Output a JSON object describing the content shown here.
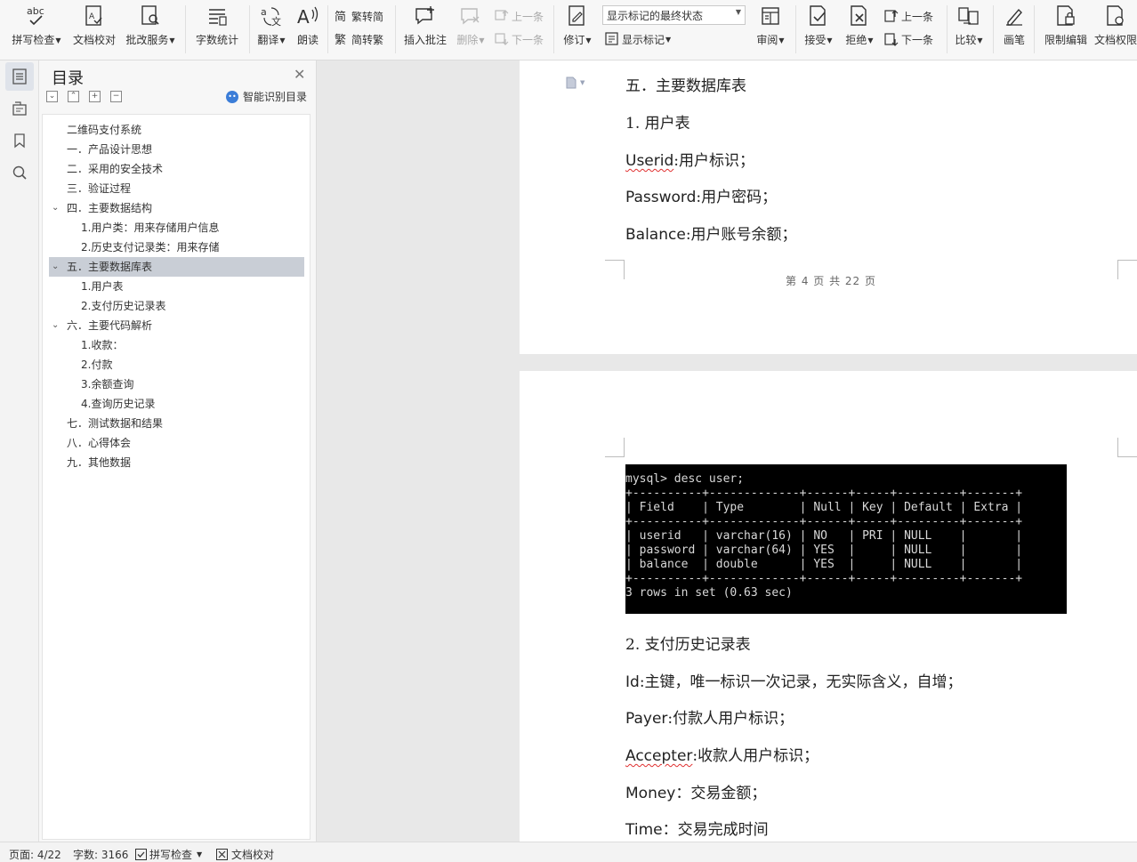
{
  "ribbon": {
    "spell_check": "拼写检查",
    "doc_proof": "文档校对",
    "revise_service": "批改服务",
    "word_count": "字数统计",
    "translate": "翻译",
    "read_aloud": "朗读",
    "trad_to_simp": "繁转简",
    "simp_to_trad": "简转繁",
    "insert_comment": "插入批注",
    "delete": "删除",
    "prev_comment": "上一条",
    "next_comment": "下一条",
    "track_changes": "修订",
    "mark_state": "显示标记的最终状态",
    "show_markup": "显示标记",
    "review": "审阅",
    "accept": "接受",
    "reject": "拒绝",
    "prev_change": "上一条",
    "next_change": "下一条",
    "compare": "比较",
    "pen": "画笔",
    "restrict_edit": "限制编辑",
    "doc_rights": "文档权限"
  },
  "toc": {
    "title": "目录",
    "smart_toc": "智能识别目录",
    "items": [
      {
        "label": "二维码支付系统",
        "level": 0
      },
      {
        "label": "一．产品设计思想",
        "level": 0
      },
      {
        "label": "二．采用的安全技术",
        "level": 0
      },
      {
        "label": "三．验证过程",
        "level": 0
      },
      {
        "label": "四．主要数据结构",
        "level": 0
      },
      {
        "label": "1.用户类：用来存储用户信息",
        "level": 1
      },
      {
        "label": "2.历史支付记录类：用来存储",
        "level": 1
      },
      {
        "label": "五．主要数据库表",
        "level": 0
      },
      {
        "label": "1.用户表",
        "level": 1
      },
      {
        "label": "2.支付历史记录表",
        "level": 1
      },
      {
        "label": "六．主要代码解析",
        "level": 0
      },
      {
        "label": "1.收款：",
        "level": 1
      },
      {
        "label": "2.付款",
        "level": 1
      },
      {
        "label": "3.余额查询",
        "level": 1
      },
      {
        "label": "4.查询历史记录",
        "level": 1
      },
      {
        "label": "七．测试数据和结果",
        "level": 0
      },
      {
        "label": "八．心得体会",
        "level": 0
      },
      {
        "label": "九．其他数据",
        "level": 0
      }
    ]
  },
  "page1": {
    "heading": "五．主要数据库表",
    "sub": "1. 用户表",
    "lines": [
      {
        "field": "Userid",
        "desc": ":用户标识；"
      },
      {
        "field": "Password",
        "desc": ":用户密码；"
      },
      {
        "field": "Balance",
        "desc": ":用户账号余额；"
      }
    ],
    "footer": "第 4 页 共 22 页"
  },
  "terminal": {
    "lines": [
      "mysql> desc user;",
      "+----------+-------------+------+-----+---------+-------+",
      "| Field    | Type        | Null | Key | Default | Extra |",
      "+----------+-------------+------+-----+---------+-------+",
      "| userid   | varchar(16) | NO   | PRI | NULL    |       |",
      "| password | varchar(64) | YES  |     | NULL    |       |",
      "| balance  | double      | YES  |     | NULL    |       |",
      "+----------+-------------+------+-----+---------+-------+",
      "3 rows in set (0.63 sec)"
    ]
  },
  "page2": {
    "sub": "2. 支付历史记录表",
    "lines": [
      {
        "field": "Id",
        "desc": ":主键，唯一标识一次记录，无实际含义，自增；"
      },
      {
        "field": "Payer",
        "desc": ":付款人用户标识；"
      },
      {
        "field": "Accepter",
        "desc": ":收款人用户标识；"
      },
      {
        "field": "Money",
        "desc": "：交易金额；"
      },
      {
        "field": "Time",
        "desc": "：交易完成时间"
      }
    ]
  },
  "status": {
    "page": "页面: 4/22",
    "words": "字数: 3166",
    "spell": "拼写检查",
    "proof": "文档校对"
  }
}
